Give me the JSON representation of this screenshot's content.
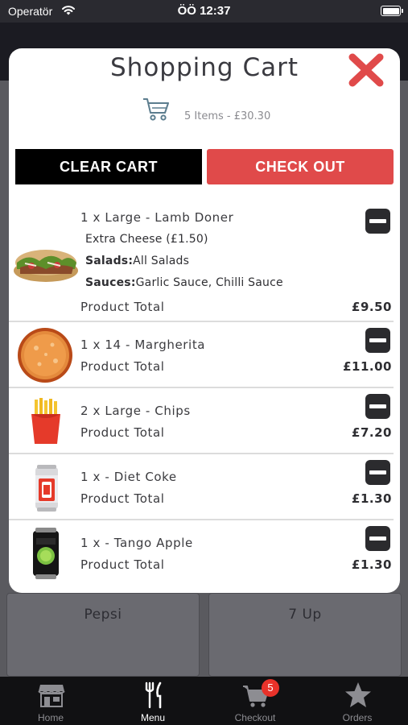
{
  "status_bar": {
    "carrier": "Operatör",
    "time": "ÖÖ 12:37"
  },
  "background": {
    "cards": [
      "Pepsi",
      "7 Up"
    ]
  },
  "cart": {
    "title": "Shopping Cart",
    "summary": "5 Items - £30.30",
    "clear_label": "CLEAR CART",
    "checkout_label": "CHECK OUT",
    "accent_color": "#e04a4a",
    "items": [
      {
        "name": "1 x Large - Lamb Doner",
        "option": "Extra Cheese (£1.50)",
        "salads_label": "Salads:",
        "salads": "All Salads",
        "sauces_label": "Sauces:",
        "sauces": "Garlic Sauce, Chilli Sauce",
        "total_label": "Product Total",
        "price": "£9.50",
        "thumb_icon": "doner-image"
      },
      {
        "name": "1 x 14 - Margherita",
        "total_label": "Product Total",
        "price": "£11.00",
        "thumb_icon": "pizza-image"
      },
      {
        "name": "2 x Large - Chips",
        "total_label": "Product Total",
        "price": "£7.20",
        "thumb_icon": "chips-image"
      },
      {
        "name": "1 x - Diet Coke",
        "total_label": "Product Total",
        "price": "£1.30",
        "thumb_icon": "diet-coke-can-image"
      },
      {
        "name": "1 x - Tango Apple",
        "total_label": "Product Total",
        "price": "£1.30",
        "thumb_icon": "tango-apple-can-image"
      }
    ]
  },
  "tabbar": {
    "tabs": [
      {
        "label": "Home",
        "icon": "store-icon"
      },
      {
        "label": "Menu",
        "icon": "fork-knife-icon",
        "active": true
      },
      {
        "label": "Checkout",
        "icon": "cart-icon",
        "badge": "5"
      },
      {
        "label": "Orders",
        "icon": "star-icon"
      }
    ]
  }
}
